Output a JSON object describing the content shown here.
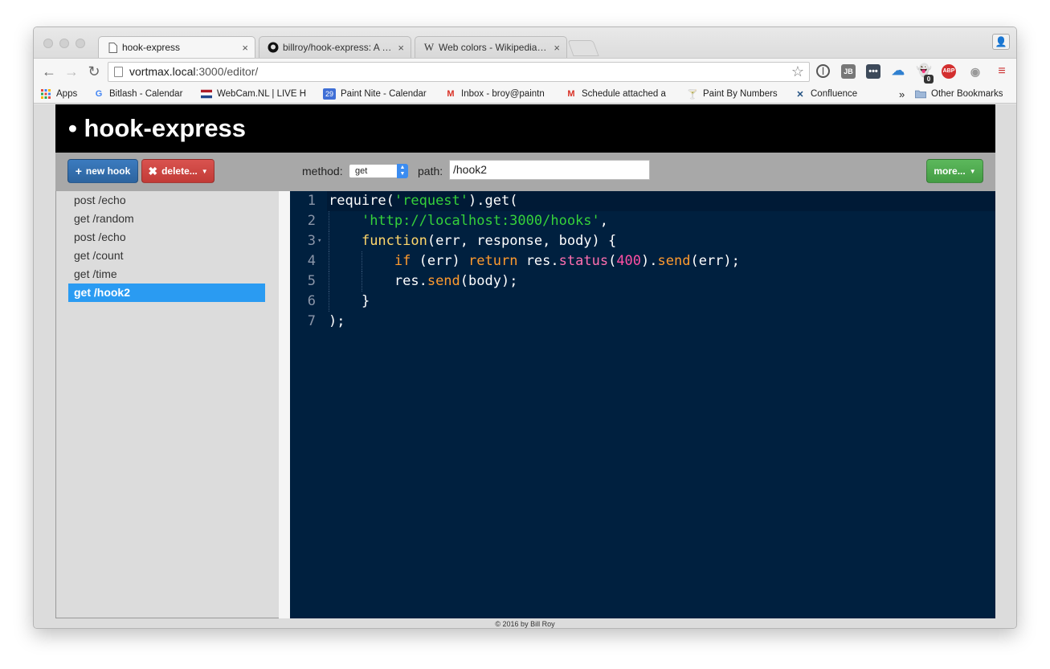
{
  "browser": {
    "tabs": [
      {
        "title": "hook-express",
        "icon": "page-icon"
      },
      {
        "title": "billroy/hook-express: A mic",
        "icon": "github-icon"
      },
      {
        "title": "Web colors - Wikipedia, the",
        "icon": "wikipedia-icon"
      }
    ],
    "tab_close": "×",
    "url_host": "vortmax.local",
    "url_rest": ":3000/editor/",
    "bookmarks": [
      {
        "label": "Apps",
        "icon": "apps-grid-icon"
      },
      {
        "label": "Bitlash - Calendar",
        "icon": "google-icon"
      },
      {
        "label": "WebCam.NL | LIVE H",
        "icon": "flag-icon"
      },
      {
        "label": "Paint Nite - Calendar",
        "icon": "calendar-icon"
      },
      {
        "label": "Inbox - broy@paintn",
        "icon": "gmail-icon"
      },
      {
        "label": "Schedule attached a",
        "icon": "gmail-icon"
      },
      {
        "label": "Paint By Numbers",
        "icon": "cocktail-icon"
      },
      {
        "label": "Confluence",
        "icon": "confluence-icon"
      }
    ],
    "bookmarks_more": "»",
    "other_bookmarks": "Other Bookmarks",
    "calendar_badge": "29",
    "ghostery_count": "0",
    "jb_label": "JB",
    "abp_label": "ABP"
  },
  "app": {
    "title": "• hook-express",
    "new_hook_label": "new hook",
    "delete_label": "delete...",
    "method_label": "method:",
    "method_value": "get",
    "path_label": "path:",
    "path_value": "/hook2",
    "more_label": "more...",
    "hooks": [
      {
        "label": "post /echo",
        "selected": false
      },
      {
        "label": "get /random",
        "selected": false
      },
      {
        "label": "post /echo",
        "selected": false
      },
      {
        "label": "get /count",
        "selected": false
      },
      {
        "label": "get /time",
        "selected": false
      },
      {
        "label": "get /hook2",
        "selected": true
      }
    ],
    "footer": "© 2016 by Bill Roy"
  },
  "editor": {
    "line_numbers": [
      "1",
      "2",
      "3",
      "4",
      "5",
      "6",
      "7"
    ],
    "lines": [
      [
        {
          "t": "require(",
          "c": ""
        },
        {
          "t": "'request'",
          "c": "str"
        },
        {
          "t": ").get(",
          "c": ""
        }
      ],
      [
        {
          "t": "    ",
          "c": ""
        },
        {
          "t": "'http://localhost:3000/hooks'",
          "c": "str"
        },
        {
          "t": ",",
          "c": ""
        }
      ],
      [
        {
          "t": "    ",
          "c": ""
        },
        {
          "t": "function",
          "c": "fn"
        },
        {
          "t": "(err, response, body) {",
          "c": ""
        }
      ],
      [
        {
          "t": "        ",
          "c": ""
        },
        {
          "t": "if",
          "c": "kw"
        },
        {
          "t": " (err) ",
          "c": ""
        },
        {
          "t": "return",
          "c": "kw"
        },
        {
          "t": " res.",
          "c": ""
        },
        {
          "t": "status",
          "c": "prop"
        },
        {
          "t": "(",
          "c": ""
        },
        {
          "t": "400",
          "c": "num"
        },
        {
          "t": ").",
          "c": ""
        },
        {
          "t": "send",
          "c": "kw"
        },
        {
          "t": "(err);",
          "c": ""
        }
      ],
      [
        {
          "t": "        res.",
          "c": ""
        },
        {
          "t": "send",
          "c": "kw"
        },
        {
          "t": "(body);",
          "c": ""
        }
      ],
      [
        {
          "t": "    }",
          "c": ""
        }
      ],
      [
        {
          "t": ");",
          "c": ""
        }
      ]
    ],
    "colors": {
      "background": "#00203f",
      "string": "#35d13a",
      "function": "#ffd76b",
      "keyword": "#ff9b2e",
      "property": "#ff6fb0",
      "number": "#ff4fa3"
    }
  }
}
